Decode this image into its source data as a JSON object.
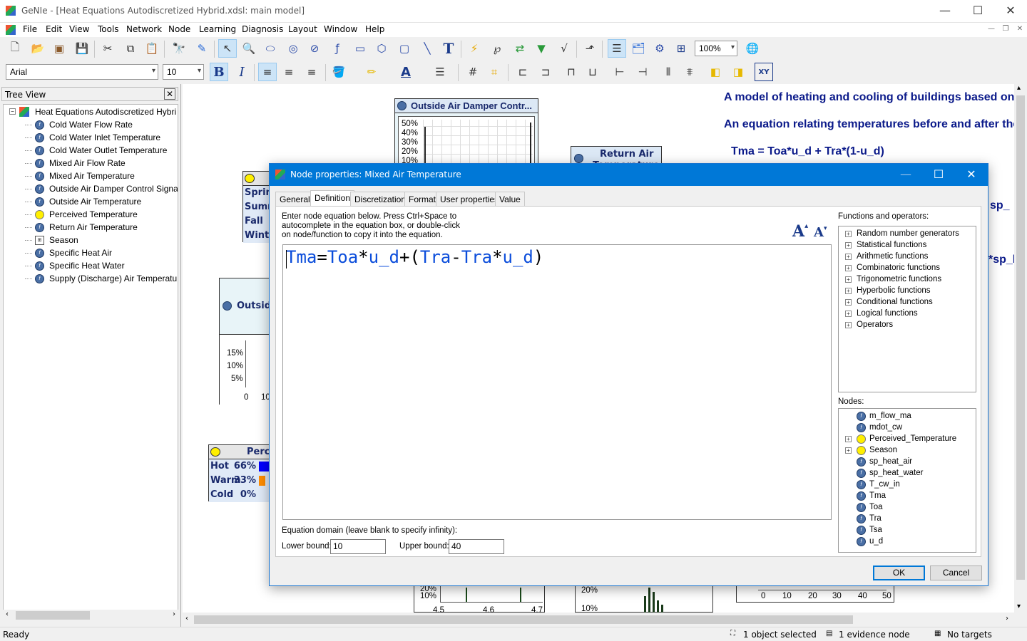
{
  "window": {
    "title": "GeNIe - [Heat Equations Autodiscretized Hybrid.xdsl: main model]"
  },
  "menu": [
    "File",
    "Edit",
    "View",
    "Tools",
    "Network",
    "Node",
    "Learning",
    "Diagnosis",
    "Layout",
    "Window",
    "Help"
  ],
  "toolbar": {
    "zoom": "100%",
    "font": "Arial",
    "font_size": "10",
    "bold_glyph": "B",
    "italic_glyph": "I",
    "text_glyph": "T",
    "color_glyph": "A",
    "xy_glyph": "XY"
  },
  "tree": {
    "title": "Tree View",
    "root": "Heat Equations Autodiscretized Hybri",
    "items": [
      {
        "label": "Cold Water Flow Rate",
        "icon": "equation-icon"
      },
      {
        "label": "Cold Water Inlet Temperature",
        "icon": "equation-icon"
      },
      {
        "label": "Cold Water Outlet Temperature",
        "icon": "equation-icon"
      },
      {
        "label": "Mixed Air Flow Rate",
        "icon": "equation-icon"
      },
      {
        "label": "Mixed Air Temperature",
        "icon": "equation-icon"
      },
      {
        "label": "Outside Air Damper Control Signa",
        "icon": "equation-icon"
      },
      {
        "label": "Outside Air Temperature",
        "icon": "equation-icon"
      },
      {
        "label": "Perceived Temperature",
        "icon": "chance-icon"
      },
      {
        "label": "Return Air Temperature",
        "icon": "equation-icon"
      },
      {
        "label": "Season",
        "icon": "deterministic-icon"
      },
      {
        "label": "Specific Heat Air",
        "icon": "equation-icon"
      },
      {
        "label": "Specific Heat Water",
        "icon": "equation-icon"
      },
      {
        "label": "Supply (Discharge) Air Temperatur",
        "icon": "equation-icon"
      }
    ]
  },
  "canvas": {
    "note1": "A model of heating and cooling of buildings based on",
    "note2": "An equation relating temperatures before and after the",
    "note3": "Tma = Toa*u_d + Tra*(1-u_d)",
    "frag_sp1": "sp_",
    "frag_sp2": "*sp_l",
    "node_damper": "Outside Air Damper Contr...",
    "node_damper_ticks": [
      "50%",
      "40%",
      "30%",
      "20%",
      "10%"
    ],
    "node_return": "Return Air",
    "node_return_sub": "Temperature",
    "node_season_states": [
      "Sprin",
      "Summ",
      "Fall",
      "Winte"
    ],
    "node_outside": "Outside",
    "node_outside_ticks": [
      "15%",
      "10%",
      "5%"
    ],
    "node_outside_x": [
      "0",
      "10"
    ],
    "node_perc": "Perce",
    "node_perc_states": [
      {
        "name": "Hot",
        "pct": "66%",
        "color": "#0000ff",
        "fill": 0.66
      },
      {
        "name": "Warm",
        "pct": "33%",
        "color": "#ff8c00",
        "fill": 0.33
      },
      {
        "name": "Cold",
        "pct": "0%",
        "color": "#888888",
        "fill": 0.0
      }
    ],
    "bottom1_ticks": [
      "20%",
      "10%"
    ],
    "bottom1_x": [
      "4.5",
      "4.6",
      "4.7"
    ],
    "bottom2_ticks": [
      "20%",
      "10%"
    ],
    "bottom3_x": [
      "0",
      "10",
      "20",
      "30",
      "40",
      "50"
    ]
  },
  "dialog": {
    "title": "Node properties: Mixed Air Temperature",
    "tabs": [
      "General",
      "Definition",
      "Discretization",
      "Format",
      "User properties",
      "Value"
    ],
    "active_tab": "Definition",
    "instructions": [
      "Enter node equation below. Press Ctrl+Space to",
      "autocomplete in the equation box, or double-click",
      "on node/function to copy it into the equation."
    ],
    "equation": "Tma=Toa*u_d+(Tra-Tra*u_d)",
    "functions_label": "Functions and operators:",
    "functions": [
      "Random number generators",
      "Statistical functions",
      "Arithmetic functions",
      "Combinatoric functions",
      "Trigonometric functions",
      "Hyperbolic functions",
      "Conditional functions",
      "Logical functions",
      "Operators"
    ],
    "nodes_label": "Nodes:",
    "nodes": [
      {
        "label": "m_flow_ma",
        "icon": "equation-icon",
        "expand": false
      },
      {
        "label": "mdot_cw",
        "icon": "equation-icon",
        "expand": false
      },
      {
        "label": "Perceived_Temperature",
        "icon": "chance-icon",
        "expand": true
      },
      {
        "label": "Season",
        "icon": "chance-icon",
        "expand": true
      },
      {
        "label": "sp_heat_air",
        "icon": "equation-icon",
        "expand": false
      },
      {
        "label": "sp_heat_water",
        "icon": "equation-icon",
        "expand": false
      },
      {
        "label": "T_cw_in",
        "icon": "equation-icon",
        "expand": false
      },
      {
        "label": "Tma",
        "icon": "equation-icon",
        "expand": false
      },
      {
        "label": "Toa",
        "icon": "equation-icon",
        "expand": false
      },
      {
        "label": "Tra",
        "icon": "equation-icon",
        "expand": false
      },
      {
        "label": "Tsa",
        "icon": "equation-icon",
        "expand": false
      },
      {
        "label": "u_d",
        "icon": "equation-icon",
        "expand": false
      }
    ],
    "domain_label": "Equation domain (leave blank to specify infinity):",
    "lower_label": "Lower bound:",
    "lower_value": "10",
    "upper_label": "Upper bound:",
    "upper_value": "40",
    "ok": "OK",
    "cancel": "Cancel"
  },
  "status": {
    "ready": "Ready",
    "selected": "1 object selected",
    "evidence": "1 evidence node",
    "targets": "No targets"
  }
}
